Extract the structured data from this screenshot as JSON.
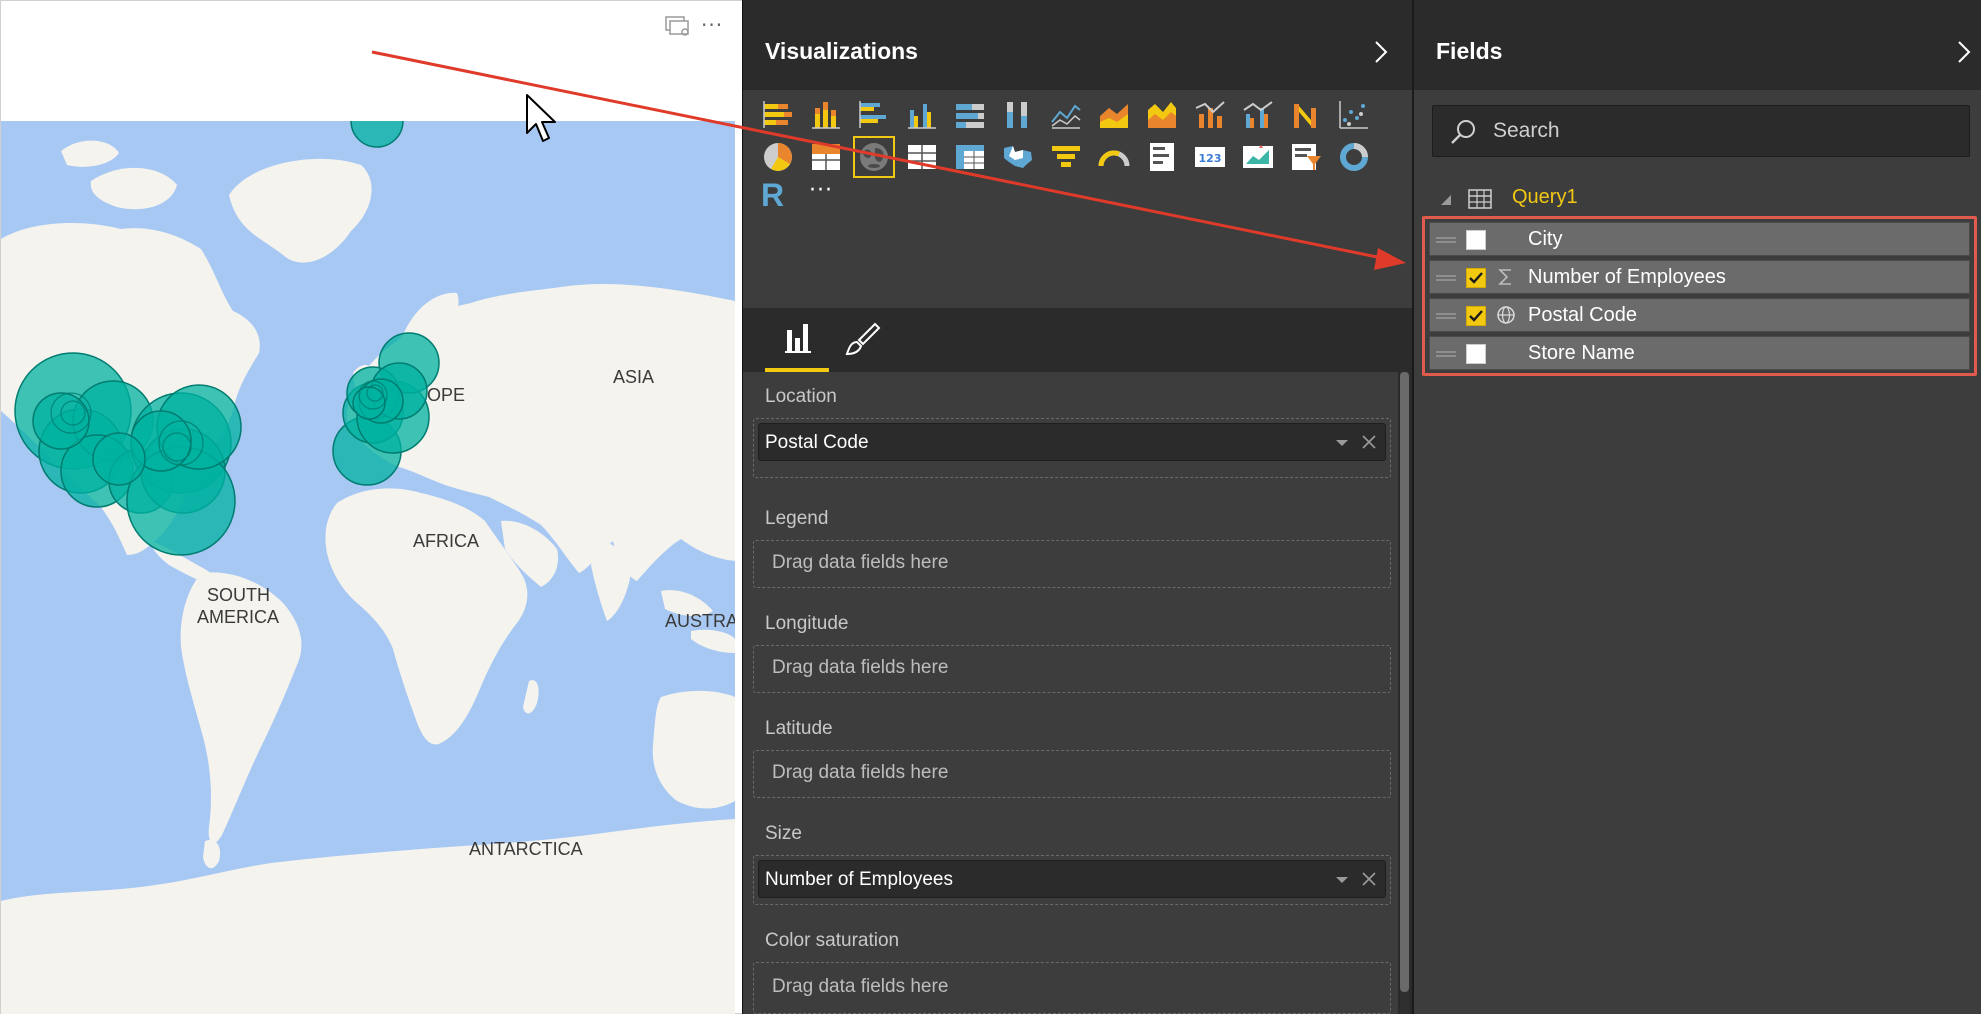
{
  "map": {
    "labels": {
      "asia": "ASIA",
      "europe": "OPE",
      "africa": "AFRICA",
      "south_america_1": "SOUTH",
      "south_america_2": "AMERICA",
      "australia": "AUSTRA",
      "antarctica": "ANTARCTICA"
    },
    "bubble_color": "#00b2a0",
    "land_color": "#f4f3ee",
    "water_color": "#a8c8f4"
  },
  "visualizations": {
    "title": "Visualizations",
    "icons": [
      "stacked-bar-chart-icon",
      "stacked-column-chart-icon",
      "clustered-bar-chart-icon",
      "clustered-column-chart-icon",
      "100-stacked-bar-chart-icon",
      "100-stacked-column-chart-icon",
      "line-chart-icon",
      "area-chart-icon",
      "stacked-area-chart-icon",
      "line-and-stacked-column-chart-icon",
      "line-and-clustered-column-chart-icon",
      "ribbon-chart-icon",
      "scatter-chart-icon",
      "pie-chart-icon",
      "treemap-icon",
      "map-icon",
      "table-icon",
      "matrix-icon",
      "filled-map-icon",
      "funnel-icon",
      "gauge-icon",
      "multi-row-card-icon",
      "card-icon",
      "kpi-icon",
      "slicer-icon",
      "donut-chart-icon",
      "r-script-visual-icon",
      "more-visuals-icon"
    ],
    "selected_icon": "map-icon",
    "r_label": "R",
    "more_label": "···"
  },
  "wells": [
    {
      "label": "Location",
      "field": "Postal Code",
      "placeholder": ""
    },
    {
      "label": "Legend",
      "field": "",
      "placeholder": "Drag data fields here"
    },
    {
      "label": "Longitude",
      "field": "",
      "placeholder": "Drag data fields here"
    },
    {
      "label": "Latitude",
      "field": "",
      "placeholder": "Drag data fields here"
    },
    {
      "label": "Size",
      "field": "Number of Employees",
      "placeholder": ""
    },
    {
      "label": "Color saturation",
      "field": "",
      "placeholder": "Drag data fields here"
    }
  ],
  "fields": {
    "title": "Fields",
    "search_placeholder": "Search",
    "table_name": "Query1",
    "items": [
      {
        "name": "City",
        "checked": false,
        "type_icon": ""
      },
      {
        "name": "Number of Employees",
        "checked": true,
        "type_icon": "sigma-icon"
      },
      {
        "name": "Postal Code",
        "checked": true,
        "type_icon": "globe-icon"
      },
      {
        "name": "Store Name",
        "checked": false,
        "type_icon": ""
      }
    ]
  },
  "colors": {
    "accent": "#f2c811",
    "annotation": "#e03a2a",
    "pane_dark": "#2b2b2b",
    "pane_mid": "#3d3d3d"
  }
}
